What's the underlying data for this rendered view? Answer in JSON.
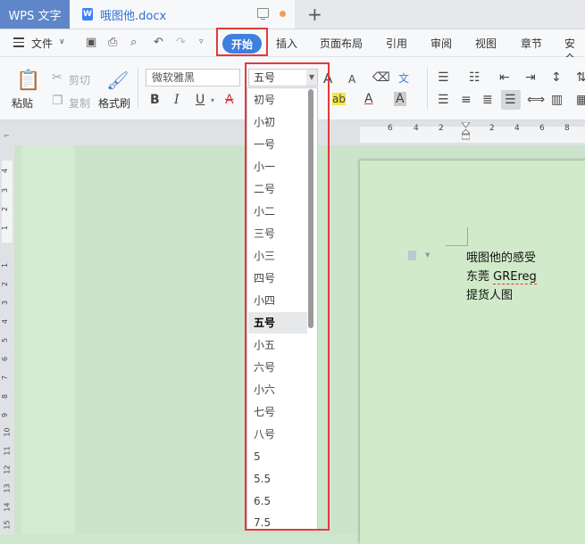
{
  "titlebar": {
    "app_name": "WPS 文字",
    "doc_tab": "哦图他.docx",
    "doc_icon_letter": "W",
    "new_tab": "+"
  },
  "menubar": {
    "file": "文件",
    "tabs": [
      "开始",
      "插入",
      "页面布局",
      "引用",
      "审阅",
      "视图",
      "章节",
      "安全"
    ]
  },
  "ribbon": {
    "paste": "粘贴",
    "cut": "剪切",
    "copy": "复制",
    "format_painter": "格式刷",
    "font_name": "微软雅黑",
    "font_size": "五号",
    "bold": "B",
    "italic": "I",
    "underline": "U",
    "strike": "A",
    "grow_font": "A",
    "shrink_font": "A",
    "font_color": "A",
    "char_shade": "A",
    "highlight": "ab"
  },
  "ruler": {
    "h_numbers": [
      "6",
      "4",
      "2",
      "2",
      "4",
      "6",
      "8"
    ],
    "v_numbers": [
      "4",
      "3",
      "2",
      "1",
      "1",
      "2",
      "3",
      "4",
      "5",
      "6",
      "7",
      "8",
      "9",
      "10",
      "11",
      "12",
      "13",
      "14",
      "15"
    ]
  },
  "font_size_dropdown": {
    "options": [
      "初号",
      "小初",
      "一号",
      "小一",
      "二号",
      "小二",
      "三号",
      "小三",
      "四号",
      "小四",
      "五号",
      "小五",
      "六号",
      "小六",
      "七号",
      "八号",
      "5",
      "5.5",
      "6.5",
      "7.5"
    ],
    "selected": "五号"
  },
  "document": {
    "lines": [
      "哦图他的感受",
      "东莞",
      "GREreg",
      "提货人图"
    ]
  },
  "colors": {
    "accent": "#3f7fde",
    "highlight_box": "#e23a3a",
    "app_tab": "#5f86c8",
    "doc_background": "#cde4cc"
  }
}
